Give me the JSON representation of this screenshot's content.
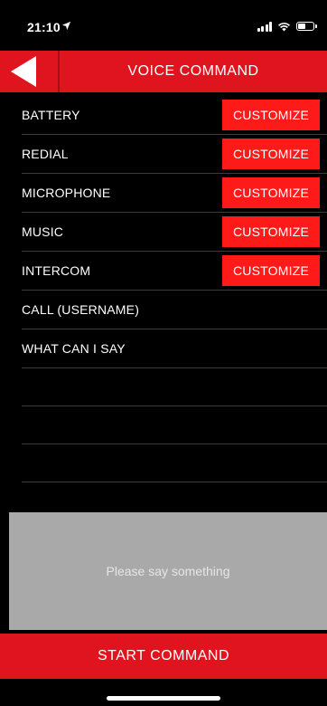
{
  "status_bar": {
    "time": "21:10",
    "location_icon": "location-arrow-icon",
    "signal_icon": "cellular-signal-icon",
    "wifi_icon": "wifi-icon",
    "battery_icon": "battery-icon",
    "battery_level": 0.55
  },
  "header": {
    "title": "VOICE COMMAND",
    "back_icon": "back-triangle-icon"
  },
  "commands": [
    {
      "label": "BATTERY",
      "action": "CUSTOMIZE"
    },
    {
      "label": "REDIAL",
      "action": "CUSTOMIZE"
    },
    {
      "label": "MICROPHONE",
      "action": "CUSTOMIZE"
    },
    {
      "label": "MUSIC",
      "action": "CUSTOMIZE"
    },
    {
      "label": "INTERCOM",
      "action": "CUSTOMIZE"
    },
    {
      "label": "CALL (USERNAME)",
      "action": null
    },
    {
      "label": "WHAT CAN I SAY",
      "action": null
    }
  ],
  "output": {
    "prompt": "Please say something"
  },
  "footer": {
    "start_label": "START COMMAND"
  },
  "colors": {
    "accent": "#e0141e",
    "customize": "#ff1a1a",
    "panel": "#a9a9a9",
    "background": "#000000"
  }
}
